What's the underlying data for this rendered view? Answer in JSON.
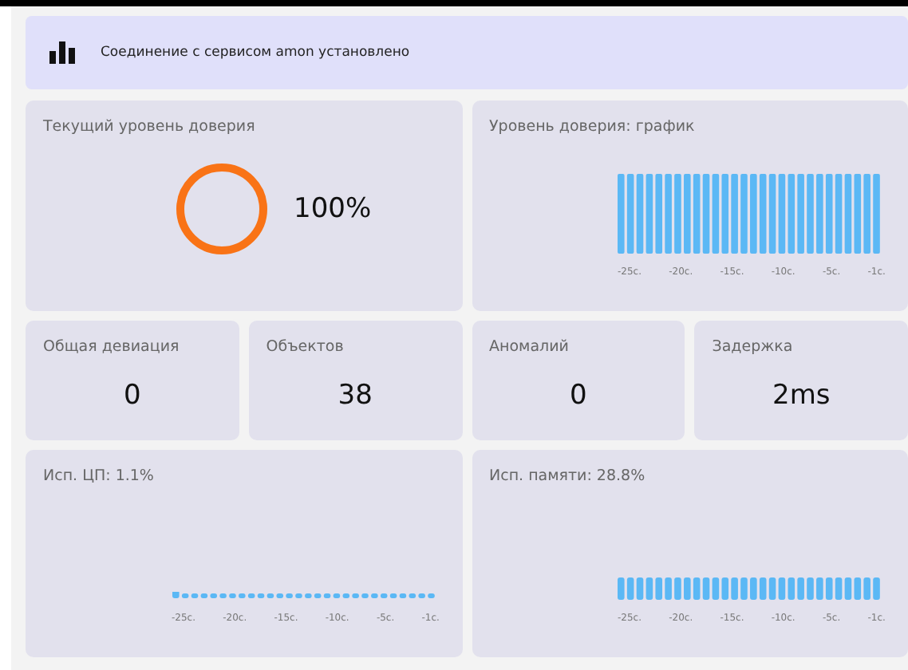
{
  "banner": {
    "text": "Соединение с сервисом amon установлено"
  },
  "trust": {
    "title": "Текущий уровень доверия",
    "level": 1,
    "reading": "100%"
  },
  "trust_chart": {
    "title": "Уровень доверия: график",
    "kind": "bars",
    "x_labels": [
      "-25c.",
      "-20c.",
      "-15c.",
      "-10c.",
      "-5c.",
      "-1c."
    ]
  },
  "stats": [
    {
      "label": "Общая девиация",
      "value": "0"
    },
    {
      "label": "Объектов",
      "value": "38"
    },
    {
      "label": "Аномалий",
      "value": "0"
    },
    {
      "label": "Задержка",
      "value": "2ms"
    }
  ],
  "cpu_chart": {
    "title": "Исп. ЦП: 1.1%",
    "kind": "dots",
    "x_labels": [
      "-25c.",
      "-20c.",
      "-15c.",
      "-10c.",
      "-5c.",
      "-1c."
    ]
  },
  "memory_chart": {
    "title": "Исп. памяти: 28.8%",
    "kind": "short-bars",
    "x_labels": [
      "-25c.",
      "-20c.",
      "-15c.",
      "-10c.",
      "-5c.",
      "-1c."
    ]
  }
}
